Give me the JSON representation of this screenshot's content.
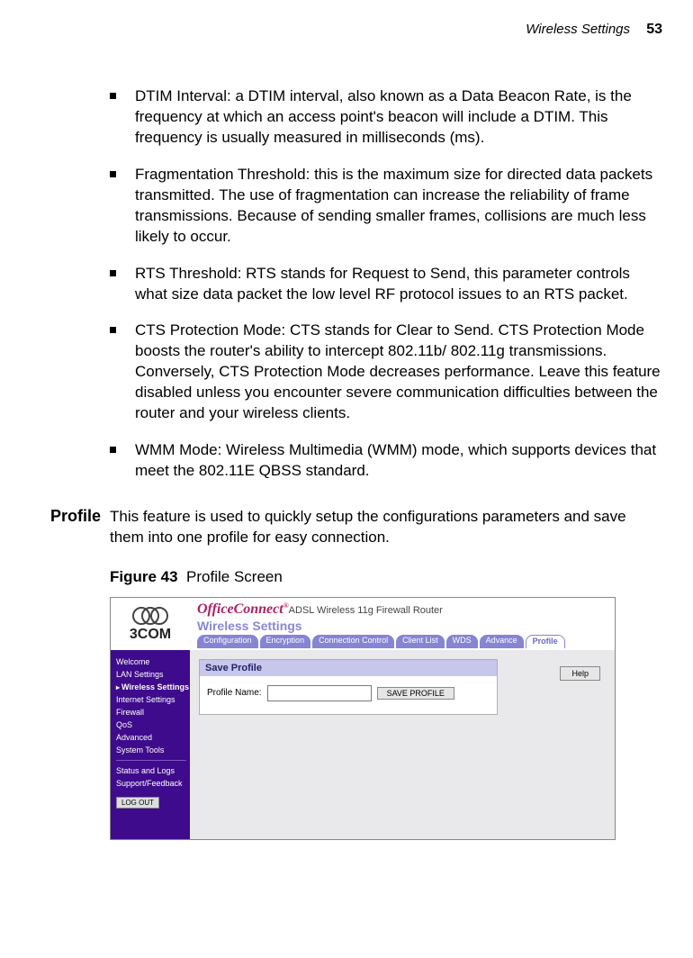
{
  "header": {
    "section": "Wireless Settings",
    "page_number": "53"
  },
  "bullets": [
    "DTIM Interval: a DTIM interval, also known as a Data Beacon Rate, is the frequency at which an access point's beacon will include a DTIM. This frequency is usually measured in milliseconds (ms).",
    "Fragmentation Threshold: this is the maximum size for directed data packets transmitted. The use of fragmentation can increase the reliability of frame transmissions. Because of sending smaller frames, collisions are much less likely to occur.",
    "RTS Threshold: RTS stands for Request to Send, this parameter controls what size data packet the low level RF protocol issues to an RTS packet.",
    "CTS Protection Mode: CTS stands for Clear to Send. CTS Protection Mode boosts the router's ability to intercept 802.11b/ 802.11g transmissions. Conversely, CTS Protection Mode decreases performance. Leave this feature disabled unless you encounter severe communication difficulties between the router and your wireless clients.",
    "WMM Mode: Wireless Multimedia (WMM) mode, which supports devices that meet the 802.11E QBSS standard."
  ],
  "profile": {
    "label": "Profile",
    "body": "This feature is used to quickly setup the configurations parameters and save them into one profile for easy connection."
  },
  "figure": {
    "number": "Figure 43",
    "caption": "Profile Screen"
  },
  "ui": {
    "logo_text": "3COM",
    "brand_main": "OfficeConnect",
    "brand_reg": "®",
    "brand_sub": "ADSL Wireless 11g Firewall Router",
    "brand_section": "Wireless Settings",
    "tabs": [
      "Configuration",
      "Encryption",
      "Connection Control",
      "Client List",
      "WDS",
      "Advance",
      "Profile"
    ],
    "active_tab_index": 6,
    "sidebar": {
      "items": [
        "Welcome",
        "LAN Settings",
        "Wireless Settings",
        "Internet Settings",
        "Firewall",
        "QoS",
        "Advanced",
        "System Tools"
      ],
      "selected_index": 2,
      "lower_items": [
        "Status and Logs",
        "Support/Feedback"
      ],
      "logout": "LOG OUT"
    },
    "panel": {
      "title": "Save Profile",
      "field_label": "Profile Name:",
      "button": "SAVE PROFILE",
      "input_value": ""
    },
    "help": "Help"
  }
}
